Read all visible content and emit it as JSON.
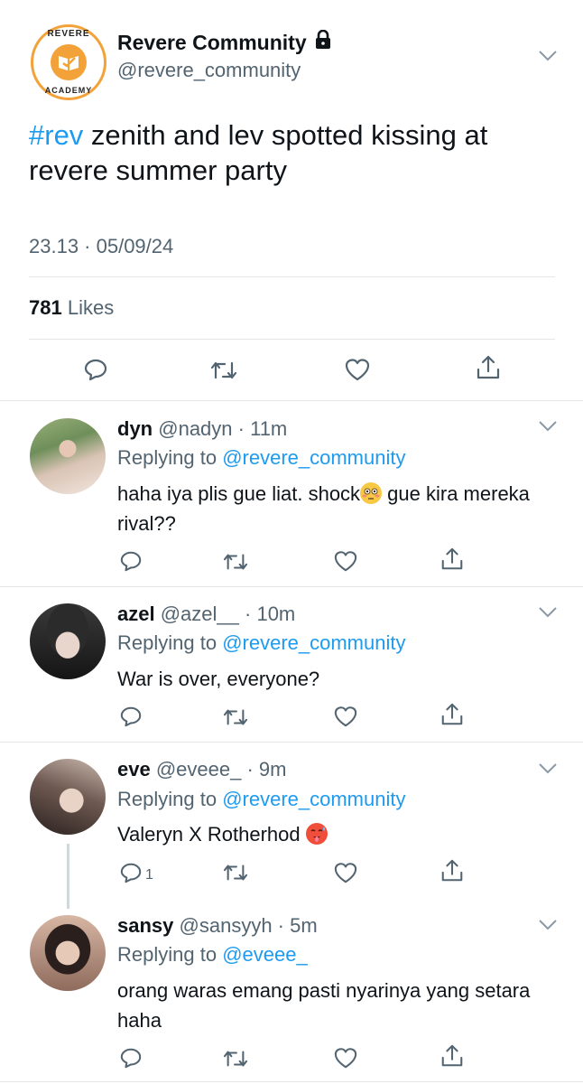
{
  "colors": {
    "accent": "#1d9bf0",
    "secondary": "#536471",
    "text": "#0f1419",
    "divider": "#e3e6e9",
    "logo_orange": "#f3a23a"
  },
  "main_tweet": {
    "logo": {
      "top_text": "REVERE",
      "bottom_text": "ACADEMY",
      "icon": "book-icon"
    },
    "name": "Revere Community",
    "lock_icon": "lock-icon",
    "handle": "@revere_community",
    "hashtag": "#rev",
    "text": " zenith and lev spotted kissing at revere summer party",
    "timestamp": "23.13 · 05/09/24",
    "likes_count": "781",
    "likes_label": " Likes",
    "actions": [
      "reply-icon",
      "retweet-icon",
      "like-icon",
      "share-icon"
    ]
  },
  "replies": [
    {
      "name": "dyn",
      "handle": "@nadyn",
      "time": "11m",
      "replying_label": "Replying to ",
      "replying_to": "@revere_community",
      "text_1": "haha iya plis gue liat. shock",
      "emoji": "flushed-face-emoji",
      "text_2": " gue kira mereka rival??",
      "reply_count": ""
    },
    {
      "name": "azel",
      "handle": "@azel__",
      "time": "10m",
      "replying_label": "Replying to ",
      "replying_to": "@revere_community",
      "text": "War is over, everyone?",
      "reply_count": ""
    },
    {
      "name": "eve",
      "handle": "@eveee_",
      "time": "9m",
      "replying_label": "Replying to ",
      "replying_to": "@revere_community",
      "text": "Valeryn X Rotherhod ",
      "emoji": "hot-face-emoji",
      "reply_count": "1"
    },
    {
      "name": "sansy",
      "handle": "@sansyyh",
      "time": "5m",
      "replying_label": "Replying to ",
      "replying_to": "@eveee_",
      "text": "orang waras emang pasti nyarinya yang setara haha",
      "reply_count": ""
    }
  ],
  "separator": " · "
}
